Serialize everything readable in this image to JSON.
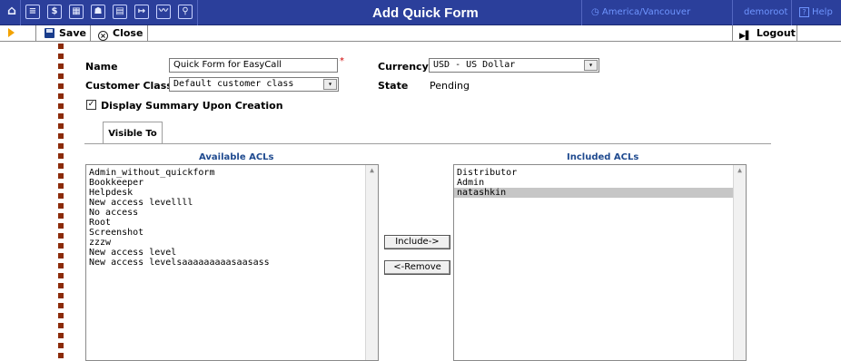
{
  "window": {
    "title": "Add Quick Form",
    "timezone": "America/Vancouver",
    "user": "demoroot",
    "help_label": "Help"
  },
  "topbar_icons": [
    "home-icon",
    "menu-icon",
    "dollar-icon",
    "grid-icon",
    "person-icon",
    "layout-icon",
    "export-icon",
    "chart-icon",
    "search-icon"
  ],
  "toolbar": {
    "save_label": "Save",
    "close_label": "Close",
    "logout_label": "Logout"
  },
  "form": {
    "name_label": "Name",
    "name_value": "Quick Form for EasyCall",
    "currency_label": "Currency",
    "currency_value": "USD - US Dollar",
    "customer_class_label": "Customer Class",
    "customer_class_value": "Default customer class",
    "state_label": "State",
    "state_value": "Pending",
    "display_summary_label": "Display Summary Upon Creation",
    "display_summary_checked": true
  },
  "tabs": [
    {
      "label": "Visible To",
      "active": true
    }
  ],
  "acl": {
    "available_title": "Available ACLs",
    "included_title": "Included ACLs",
    "available": [
      "Admin_without_quickform",
      "Bookkeeper",
      "Helpdesk",
      "New access levellll",
      "No access",
      "Root",
      "Screenshot",
      "zzzw",
      "New access level",
      "New access levelsaaaaaaaaasaasass"
    ],
    "included": [
      "Distributor",
      "Admin",
      "natashkin"
    ],
    "included_selected": "natashkin",
    "include_button": "Include->",
    "remove_button": "<-Remove"
  },
  "colors": {
    "topbar": "#2b3f9b",
    "link": "#6f95ff",
    "acl_header": "#1f4a8f",
    "dash": "#8b2a08",
    "toolbar_arrow": "#f2a200"
  }
}
